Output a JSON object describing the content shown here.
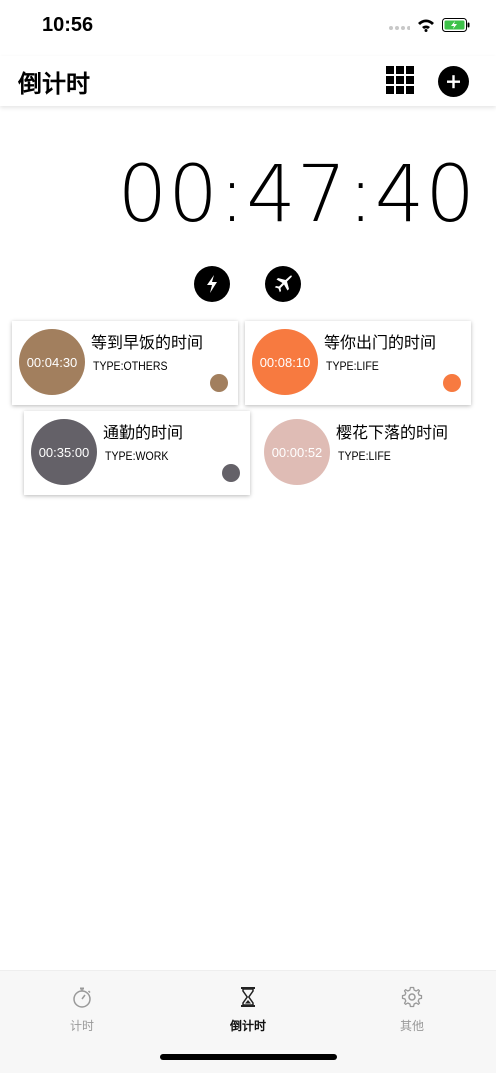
{
  "status_bar": {
    "time": "10:56"
  },
  "nav": {
    "title": "倒计时"
  },
  "main_timer": "00:47:40",
  "cards": [
    {
      "time": "00:04:30",
      "title": "等到早饭的时间",
      "type": "TYPE:OTHERS",
      "color": "#a27f5e"
    },
    {
      "time": "00:08:10",
      "title": "等你出门的时间",
      "type": "TYPE:LIFE",
      "color": "#f77a40"
    },
    {
      "time": "00:35:00",
      "title": "通勤的时间",
      "type": "TYPE:WORK",
      "color": "#646168"
    },
    {
      "time": "00:00:52",
      "title": "樱花下落的时间",
      "type": "TYPE:LIFE",
      "color": "#dfbcb5"
    }
  ],
  "tabs": [
    {
      "label": "计时",
      "icon": "stopwatch-icon"
    },
    {
      "label": "倒计时",
      "icon": "hourglass-icon",
      "active": true
    },
    {
      "label": "其他",
      "icon": "gear-icon"
    }
  ]
}
